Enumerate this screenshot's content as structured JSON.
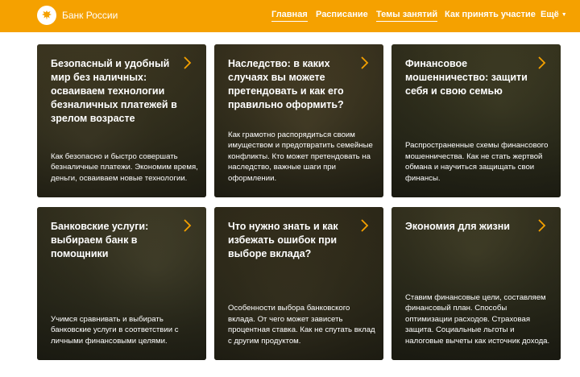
{
  "header": {
    "brand": "Банк России",
    "brand_color": "#f5a100",
    "nav": [
      {
        "label": "Главная",
        "active": true
      },
      {
        "label": "Расписание",
        "active": false
      },
      {
        "label": "Темы занятий",
        "active": true
      },
      {
        "label": "Как принять участие",
        "active": false
      },
      {
        "label": "Ещё",
        "active": false
      }
    ]
  },
  "cards": [
    {
      "title": "Безопасный и удобный мир без наличных: осваиваем технологии безналичных платежей в зрелом возрасте",
      "desc": "Как безопасно и быстро совершать безналичные платежи. Экономим время, деньги, осваиваем новые технологии."
    },
    {
      "title": "Наследство: в каких случаях вы можете претендовать и как его правильно оформить?",
      "desc": "Как грамотно распорядиться своим имуществом и предотвратить семейные конфликты. Кто может претендовать на наследство, важные шаги при оформлении."
    },
    {
      "title": "Финансовое мошенничество: защити себя и свою семью",
      "desc": "Распространенные схемы финансового мошенничества. Как не стать жертвой обмана и научиться защищать свои финансы."
    },
    {
      "title": "Банковские услуги: выбираем банк в помощники",
      "desc": "Учимся сравнивать и выбирать банковские услуги в соответствии с личными финансовыми целями."
    },
    {
      "title": "Что нужно знать и как избежать ошибок при выборе вклада?",
      "desc": "Особенности выбора банковского вклада. От чего может зависеть процентная ставка. Как не спутать вклад с другим продуктом."
    },
    {
      "title": "Экономия для жизни",
      "desc": "Ставим финансовые цели, составляем финансовый план. Способы оптимизации расходов. Страховая защита. Социальные льготы и налоговые вычеты как источник дохода."
    }
  ],
  "icons": {
    "logo": "eagle-emblem-icon",
    "card_arrow": "chevron-right-icon",
    "more_caret": "caret-down-icon"
  },
  "accent_color": "#f5a100"
}
